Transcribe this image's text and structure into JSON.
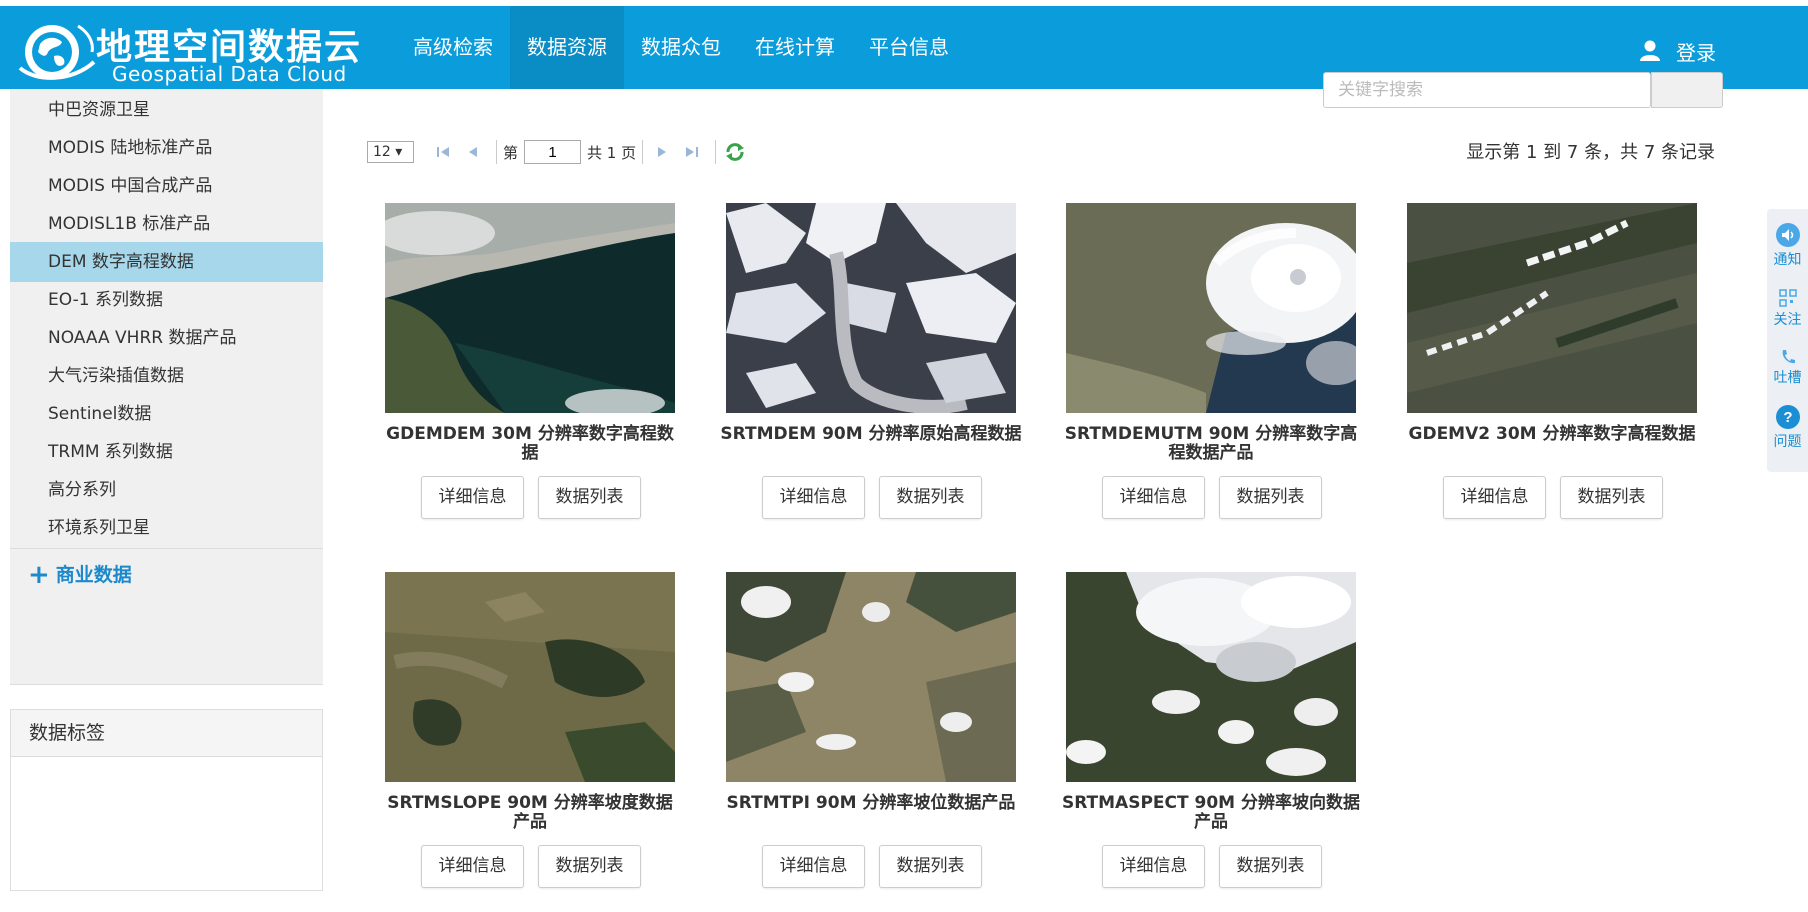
{
  "header": {
    "logo_cn": "地理空间数据云",
    "logo_en": "Geospatial Data Cloud",
    "nav": [
      "高级检索",
      "数据资源",
      "数据众包",
      "在线计算",
      "平台信息"
    ],
    "active_nav": "数据资源",
    "login": "登录",
    "bg_color": "#0b9ddb"
  },
  "sidebar": {
    "items": [
      "中巴资源卫星",
      "MODIS 陆地标准产品",
      "MODIS 中国合成产品",
      "MODISL1B 标准产品",
      "DEM 数字高程数据",
      "EO-1 系列数据",
      "NOAAA VHRR 数据产品",
      "大气污染插值数据",
      "Sentinel数据",
      "TRMM 系列数据",
      "高分系列",
      "环境系列卫星"
    ],
    "active_item": "DEM 数字高程数据",
    "commercial": "商业数据",
    "tags_title": "数据标签"
  },
  "search": {
    "placeholder": "关键字搜索"
  },
  "pager": {
    "page_size": "12 ▾",
    "page_prefix": "第",
    "page_value": "1",
    "page_suffix": "共 1 页",
    "info": "显示第 1 到 7 条，共 7 条记录"
  },
  "cards": [
    {
      "title": "GDEMDEM 30M 分辨率数字高程数据",
      "detail": "详细信息",
      "list": "数据列表"
    },
    {
      "title": "SRTMDEM 90M 分辨率原始高程数据",
      "detail": "详细信息",
      "list": "数据列表"
    },
    {
      "title": "SRTMDEMUTM 90M 分辨率数字高程数据产品",
      "detail": "详细信息",
      "list": "数据列表"
    },
    {
      "title": "GDEMV2 30M 分辨率数字高程数据",
      "detail": "详细信息",
      "list": "数据列表"
    },
    {
      "title": "SRTMSLOPE 90M 分辨率坡度数据产品",
      "detail": "详细信息",
      "list": "数据列表"
    },
    {
      "title": "SRTMTPI 90M 分辨率坡位数据产品",
      "detail": "详细信息",
      "list": "数据列表"
    },
    {
      "title": "SRTMASPECT 90M 分辨率坡向数据产品",
      "detail": "详细信息",
      "list": "数据列表"
    }
  ],
  "float_bar": [
    "通知",
    "关注",
    "吐槽",
    "问题"
  ]
}
